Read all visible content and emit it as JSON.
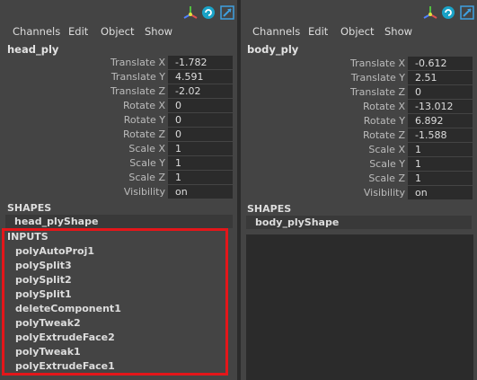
{
  "left": {
    "menu": [
      "Channels",
      "Edit",
      "Object",
      "Show"
    ],
    "object_name": "head_ply",
    "attributes": [
      {
        "label": "Translate X",
        "value": "-1.782"
      },
      {
        "label": "Translate Y",
        "value": "4.591"
      },
      {
        "label": "Translate Z",
        "value": "-2.02"
      },
      {
        "label": "Rotate X",
        "value": "0"
      },
      {
        "label": "Rotate Y",
        "value": "0"
      },
      {
        "label": "Rotate Z",
        "value": "0"
      },
      {
        "label": "Scale X",
        "value": "1"
      },
      {
        "label": "Scale Y",
        "value": "1"
      },
      {
        "label": "Scale Z",
        "value": "1"
      },
      {
        "label": "Visibility",
        "value": "on"
      }
    ],
    "shapes_title": "SHAPES",
    "shape": "head_plyShape",
    "inputs_title": "INPUTS",
    "inputs": [
      "polyAutoProj1",
      "polySplit3",
      "polySplit2",
      "polySplit1",
      "deleteComponent1",
      "polyTweak2",
      "polyExtrudeFace2",
      "polyTweak1",
      "polyExtrudeFace1"
    ],
    "highlight_color": "#e4161a"
  },
  "right": {
    "menu": [
      "Channels",
      "Edit",
      "Object",
      "Show"
    ],
    "object_name": "body_ply",
    "attributes": [
      {
        "label": "Translate X",
        "value": "-0.612"
      },
      {
        "label": "Translate Y",
        "value": "2.51"
      },
      {
        "label": "Translate Z",
        "value": "0"
      },
      {
        "label": "Rotate X",
        "value": "-13.012"
      },
      {
        "label": "Rotate Y",
        "value": "6.892"
      },
      {
        "label": "Rotate Z",
        "value": "-1.588"
      },
      {
        "label": "Scale X",
        "value": "1"
      },
      {
        "label": "Scale Y",
        "value": "1"
      },
      {
        "label": "Scale Z",
        "value": "1"
      },
      {
        "label": "Visibility",
        "value": "on"
      }
    ],
    "shapes_title": "SHAPES",
    "shape": "body_plyShape"
  },
  "icons": [
    "transform-axes-icon",
    "circle-arrow-icon",
    "expand-arrow-icon"
  ]
}
